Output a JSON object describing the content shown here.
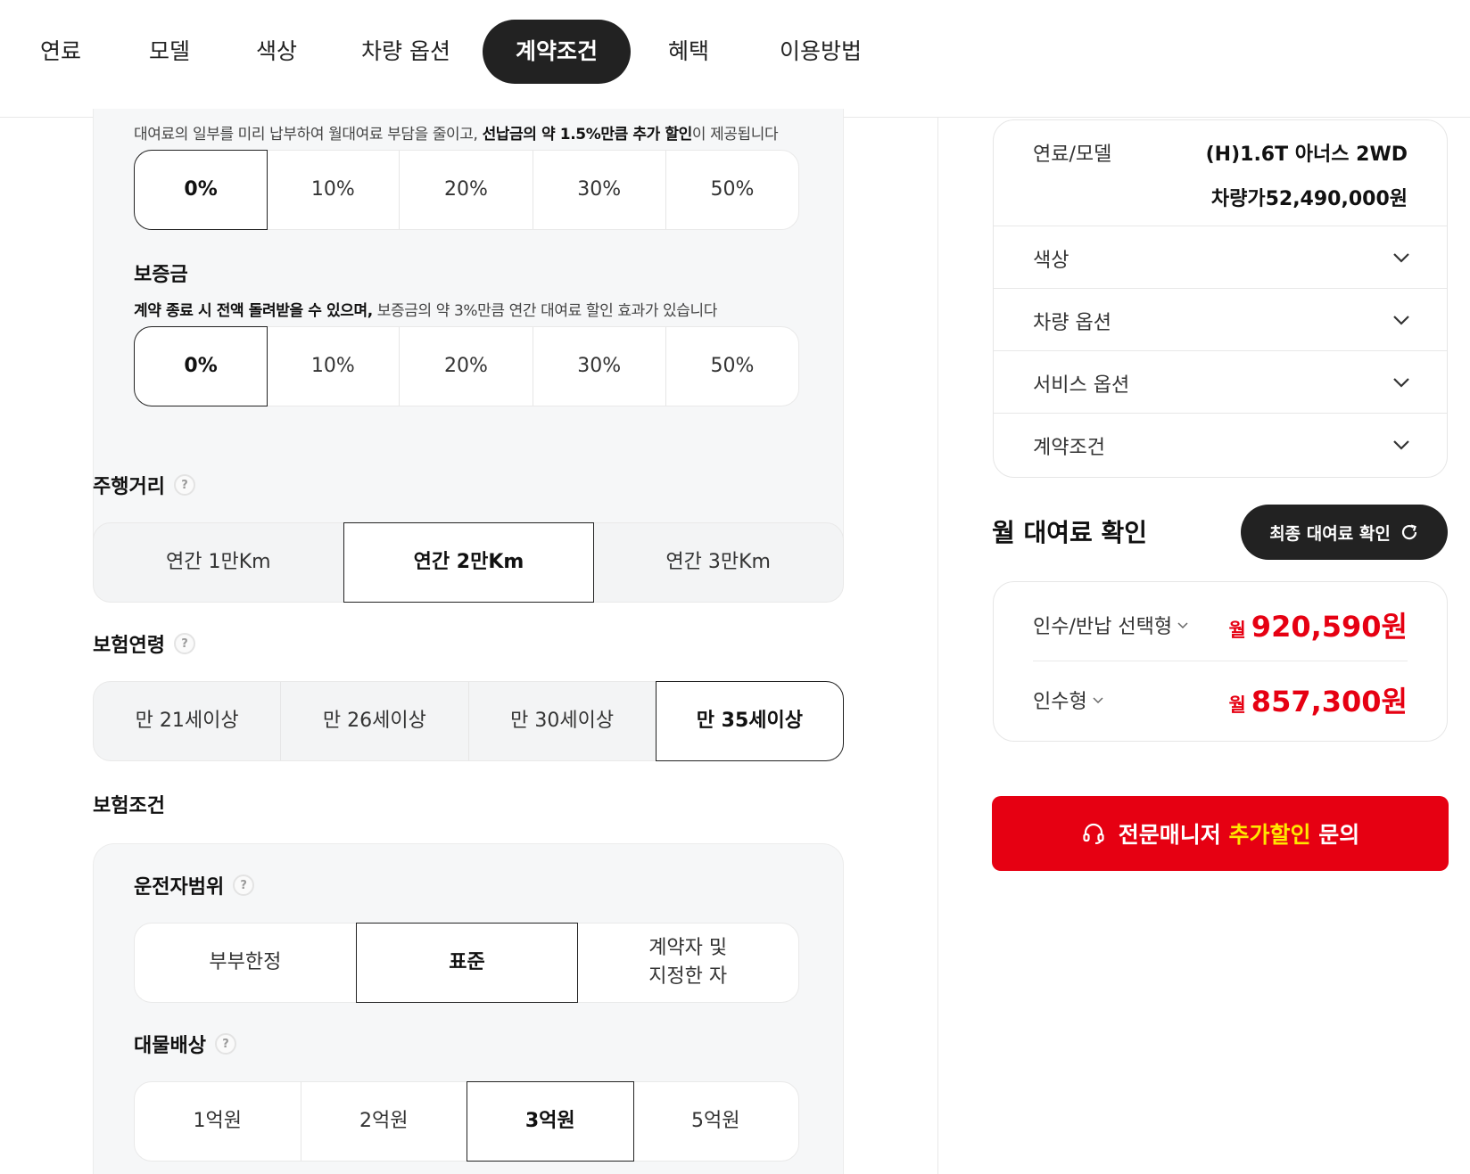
{
  "tabs": [
    "연료",
    "모델",
    "색상",
    "차량 옵션",
    "계약조건",
    "혜택",
    "이용방법"
  ],
  "active_tab": "계약조건",
  "prepayment": {
    "note_plain1": "대여료의 일부를 미리 납부하여 월대여료 부담을 줄이고, ",
    "note_bold": "선납금의 약 1.5%만큼 추가 할인",
    "note_plain2": "이 제공됩니다",
    "options": [
      "0%",
      "10%",
      "20%",
      "30%",
      "50%"
    ],
    "selected": "0%"
  },
  "deposit": {
    "title": "보증금",
    "note_bold": "계약 종료 시 전액 돌려받을 수 있으며,",
    "note_plain": " 보증금의 약 3%만큼 연간 대여료 할인 효과가 있습니다",
    "options": [
      "0%",
      "10%",
      "20%",
      "30%",
      "50%"
    ],
    "selected": "0%"
  },
  "mileage": {
    "title": "주행거리",
    "help": "?",
    "options": [
      "연간 1만Km",
      "연간 2만Km",
      "연간 3만Km"
    ],
    "selected": "연간 2만Km"
  },
  "insurance_age": {
    "title": "보험연령",
    "help": "?",
    "options": [
      "만 21세이상",
      "만 26세이상",
      "만 30세이상",
      "만 35세이상"
    ],
    "selected": "만 35세이상"
  },
  "insurance_terms": {
    "title": "보험조건",
    "driver_scope": {
      "title": "운전자범위",
      "help": "?",
      "options": [
        "부부한정",
        "표준",
        "계약자 및\n지정한 자"
      ],
      "selected": "표준"
    },
    "property_damage": {
      "title": "대물배상",
      "help": "?",
      "options": [
        "1억원",
        "2억원",
        "3억원",
        "5억원"
      ],
      "selected": "3억원"
    }
  },
  "summary": {
    "fuel_model_label": "연료/모델",
    "fuel_model_value": "(H)1.6T 아너스 2WD",
    "price_label": "차량가",
    "price_value": "52,490,000원",
    "rows": [
      "색상",
      "차량 옵션",
      "서비스 옵션",
      "계약조건"
    ]
  },
  "rent_check": {
    "title": "월 대여료 확인",
    "final_button": "최종 대여료 확인"
  },
  "prices": [
    {
      "type": "인수/반납 선택형",
      "unit": "월",
      "amount": "920,590원"
    },
    {
      "type": "인수형",
      "unit": "월",
      "amount": "857,300원"
    }
  ],
  "cta": {
    "part1": "전문매니저 ",
    "highlight": "추가할인",
    "part2": " 문의"
  },
  "colors": {
    "accent": "#e60012",
    "highlight": "#ffe600",
    "dark": "#222222"
  }
}
